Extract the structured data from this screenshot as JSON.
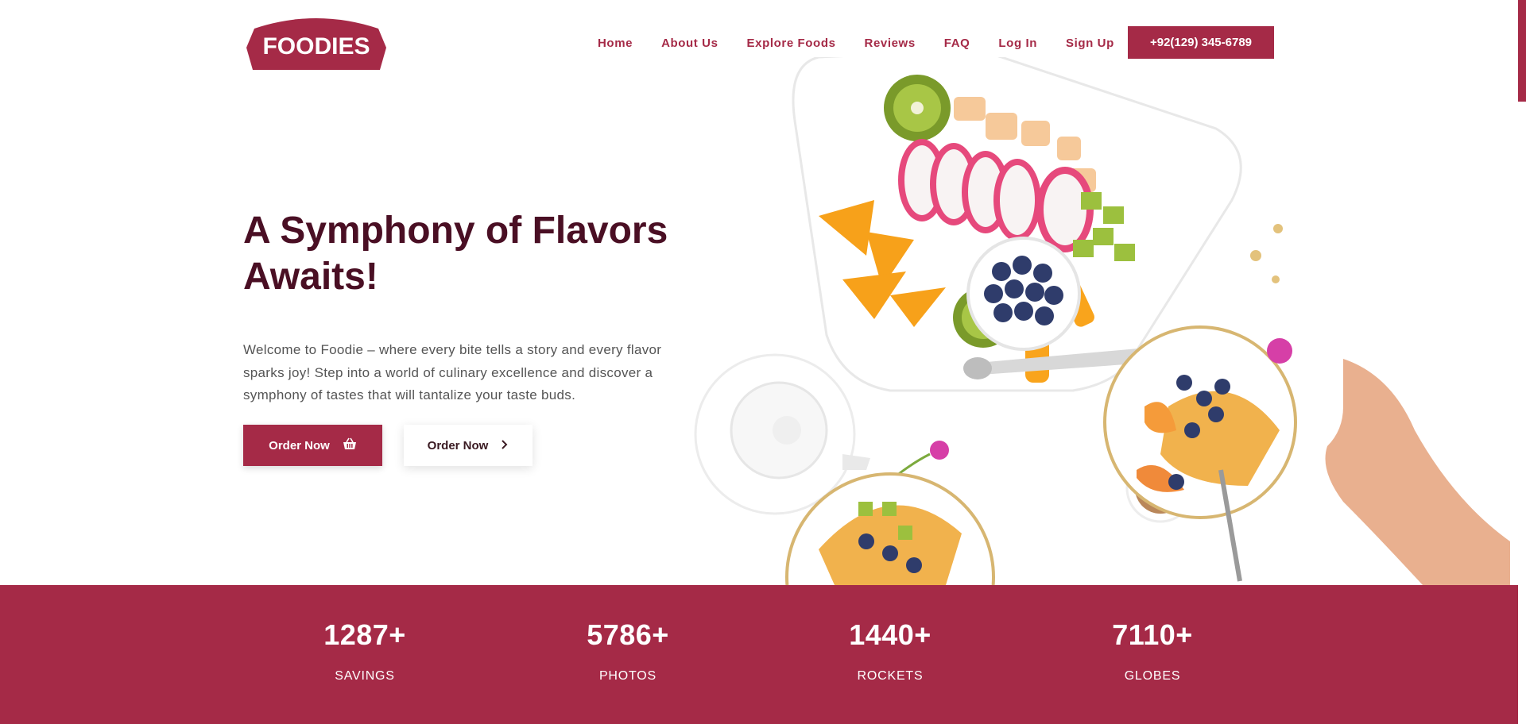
{
  "brand": {
    "name": "FOODIES",
    "color": "#a52a47"
  },
  "nav": {
    "items": [
      {
        "label": "Home"
      },
      {
        "label": "About Us"
      },
      {
        "label": "Explore Foods"
      },
      {
        "label": "Reviews"
      },
      {
        "label": "FAQ"
      },
      {
        "label": "Log In"
      },
      {
        "label": "Sign Up"
      }
    ],
    "phone": "+92(129) 345-6789"
  },
  "hero": {
    "title": "A Symphony of Flavors Awaits!",
    "text": "Welcome to Foodie – where every bite tells a story and every flavor sparks joy! Step into a world of culinary excellence and discover a symphony of tastes that will tantalize your taste buds.",
    "primary_button": {
      "label": "Order Now",
      "icon": "basket-icon"
    },
    "secondary_button": {
      "label": "Order Now",
      "icon": "chevron-right-icon"
    }
  },
  "stats": [
    {
      "value": "1287+",
      "label": "SAVINGS"
    },
    {
      "value": "5786+",
      "label": "PHOTOS"
    },
    {
      "value": "1440+",
      "label": "ROCKETS"
    },
    {
      "value": "7110+",
      "label": "GLOBES"
    }
  ]
}
